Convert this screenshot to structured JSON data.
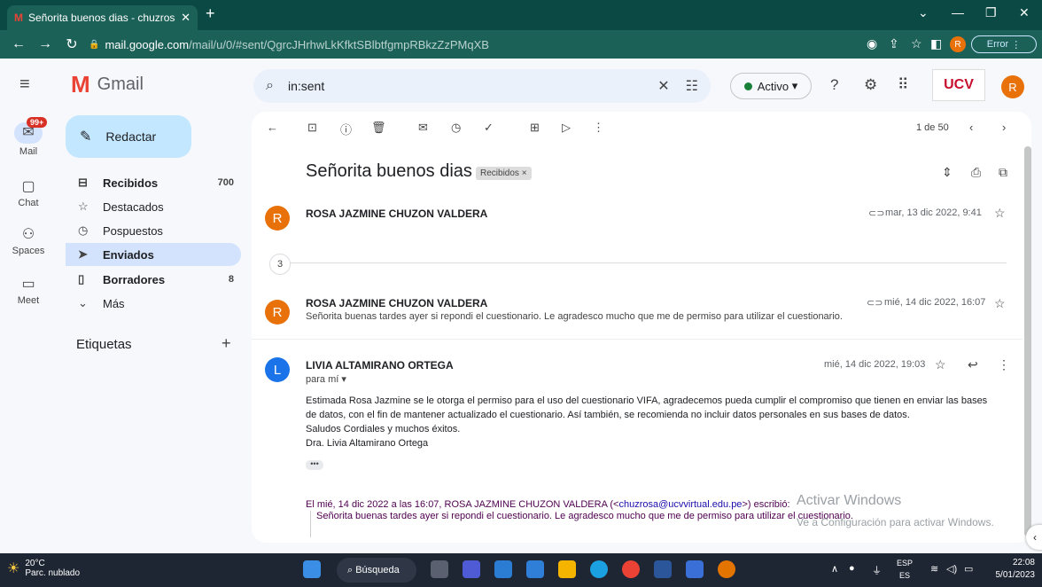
{
  "browser": {
    "tab_title": "Señorita buenos dias - chuzrosa@",
    "url_host": "mail.google.com",
    "url_path": "/mail/u/0/#sent/QgrcJHrhwLkKfktSBlbtfgmpRBkzZzPMqXB",
    "error_label": "Error",
    "profile_letter": "R"
  },
  "gmail": {
    "logo_text": "Gmail",
    "search_value": "in:sent",
    "status_label": "Activo",
    "avatar_letter": "R",
    "org_logo": "UCV"
  },
  "rail": {
    "mail_badge": "99+",
    "items": [
      "Mail",
      "Chat",
      "Spaces",
      "Meet"
    ]
  },
  "sidebar": {
    "compose_label": "Redactar",
    "items": [
      {
        "label": "Recibidos",
        "count": "700"
      },
      {
        "label": "Destacados",
        "count": ""
      },
      {
        "label": "Pospuestos",
        "count": ""
      },
      {
        "label": "Enviados",
        "count": ""
      },
      {
        "label": "Borradores",
        "count": "8"
      },
      {
        "label": "Más",
        "count": ""
      }
    ],
    "labels_title": "Etiquetas"
  },
  "thread": {
    "pager": "1 de 50",
    "subject": "Señorita buenos dias",
    "label_chip": "Recibidos ×",
    "collapsed_count": "3",
    "messages": [
      {
        "avatar": "R",
        "sender": "ROSA JAZMINE CHUZON VALDERA",
        "date": "mar, 13 dic 2022, 9:41",
        "snippet": ""
      },
      {
        "avatar": "R",
        "sender": "ROSA JAZMINE CHUZON VALDERA",
        "date": "mié, 14 dic 2022, 16:07",
        "snippet": "Señorita buenas tardes ayer si repondi el cuestionario. Le agradesco mucho que me de permiso para utilizar el cuestionario."
      },
      {
        "avatar": "L",
        "sender": "LIVIA ALTAMIRANO ORTEGA",
        "date": "mié, 14 dic 2022, 19:03",
        "to": "para mí"
      }
    ],
    "body": [
      "Estimada Rosa Jazmine se le otorga el permiso para el uso del cuestionario VIFA, agradecemos pueda cumplir el compromiso que tienen en enviar las bases",
      "de datos, con el fin de mantener actualizado el cuestionario. Así también, se recomienda no incluir datos personales en sus bases de datos.",
      "Saludos Cordiales y muchos éxitos.",
      "Dra. Livia Altamirano Ortega"
    ],
    "quote_header_pre": "El mié, 14 dic 2022 a las 16:07, ROSA JAZMINE CHUZON VALDERA (<",
    "quote_email": "chuzrosa@ucvvirtual.edu.pe",
    "quote_header_post": ">) escribió:",
    "quote_text": "Señorita buenas tardes ayer si repondi el cuestionario. Le agradesco mucho que me de permiso para utilizar el cuestionario."
  },
  "watermark": {
    "line1": "Activar Windows",
    "line2": "Ve a Configuración para activar Windows."
  },
  "taskbar": {
    "temp": "20°C",
    "weather": "Parc. nublado",
    "search_label": "Búsqueda",
    "lang1": "ESP",
    "lang2": "ES",
    "time": "22:08",
    "date": "5/01/2023"
  }
}
